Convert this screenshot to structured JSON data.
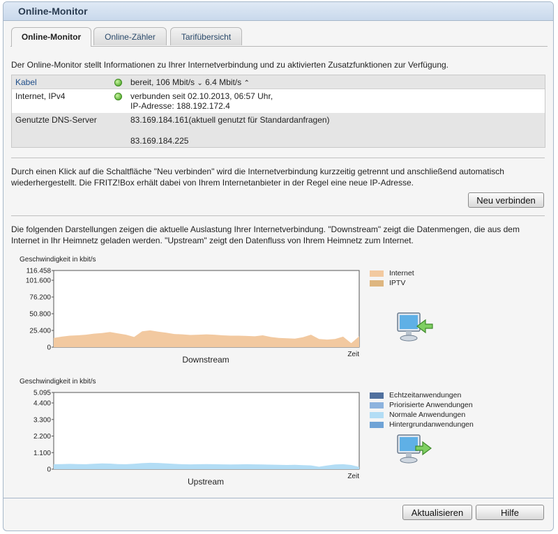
{
  "window": {
    "title": "Online-Monitor"
  },
  "tabs": [
    {
      "label": "Online-Monitor",
      "active": true
    },
    {
      "label": "Online-Zähler",
      "active": false
    },
    {
      "label": "Tarifübersicht",
      "active": false
    }
  ],
  "intro_text": "Der Online-Monitor stellt Informationen zu Ihrer Internetverbindung und zu aktivierten Zusatzfunktionen zur Verfügung.",
  "info_table": {
    "kabel": {
      "label": "Kabel",
      "status": "bereit, 106 Mbit/s",
      "down_arrow": "⌄",
      "upstream": "6.4 Mbit/s",
      "up_arrow": "⌃"
    },
    "internet": {
      "label": "Internet, IPv4",
      "line1": "verbunden seit 02.10.2013, 06:57 Uhr,",
      "line2": "IP-Adresse: 188.192.172.4"
    },
    "dns": {
      "label": "Genutzte DNS-Server",
      "server1": "83.169.184.161(aktuell genutzt für Standardanfragen)",
      "server2": "83.169.184.225"
    }
  },
  "reconnect_text": "Durch einen Klick auf die Schaltfläche \"Neu verbinden\" wird die Internetverbindung kurzzeitig getrennt und anschließend automatisch wiederhergestellt. Die FRITZ!Box erhält dabei von Ihrem Internetanbieter in der Regel eine neue IP-Adresse.",
  "reconnect_button": "Neu verbinden",
  "charts_text": "Die folgenden Darstellungen zeigen die aktuelle Auslastung Ihrer Internetverbindung. \"Downstream\" zeigt die Datenmengen, die aus dem Internet in Ihr Heimnetz geladen werden. \"Upstream\" zeigt den Datenfluss von Ihrem Heimnetz zum Internet.",
  "colors": {
    "internet": "#f2c9a0",
    "iptv": "#deb680",
    "echtzeit": "#50709e",
    "priorisiert": "#8db3de",
    "normal": "#b3ddf5",
    "hintergrund": "#6fa3d6",
    "upstream_fill": "#b3ddf5"
  },
  "chart_data": [
    {
      "type": "area",
      "title": "Downstream",
      "ylabel": "Geschwindigkeit in kbit/s",
      "xlabel": "Zeit",
      "ylim": [
        0,
        116458
      ],
      "yticks": [
        "116.458",
        "101.600",
        "76.200",
        "50.800",
        "25.400",
        "0"
      ],
      "ytick_values": [
        116458,
        101600,
        76200,
        50800,
        25400,
        0
      ],
      "series": [
        {
          "name": "Internet",
          "values": [
            14000,
            16000,
            17500,
            18000,
            19000,
            20500,
            21500,
            23000,
            21000,
            19000,
            15500,
            24000,
            25500,
            23500,
            22000,
            20000,
            19500,
            18500,
            19000,
            19500,
            19000,
            18000,
            17500,
            17500,
            17000,
            16500,
            18000,
            15500,
            14000,
            13500,
            13000,
            15000,
            19000,
            12500,
            11500,
            12500,
            16000,
            6000,
            16500
          ]
        },
        {
          "name": "IPTV",
          "values": []
        }
      ],
      "legend": [
        "Internet",
        "IPTV"
      ],
      "legend_position": "right"
    },
    {
      "type": "area",
      "title": "Upstream",
      "ylabel": "Geschwindigkeit in kbit/s",
      "xlabel": "Zeit",
      "ylim": [
        0,
        5095
      ],
      "yticks": [
        "5.095",
        "4.400",
        "3.300",
        "2.200",
        "1.100",
        "0"
      ],
      "ytick_values": [
        5095,
        4400,
        3300,
        2200,
        1100,
        0
      ],
      "series": [
        {
          "name": "Echtzeitanwendungen",
          "values": []
        },
        {
          "name": "Priorisierte Anwendungen",
          "values": []
        },
        {
          "name": "Normale Anwendungen",
          "values": [
            330,
            340,
            350,
            340,
            330,
            360,
            380,
            370,
            340,
            330,
            360,
            400,
            420,
            410,
            380,
            350,
            330,
            320,
            330,
            340,
            330,
            320,
            310,
            320,
            330,
            320,
            310,
            300,
            290,
            280,
            290,
            270,
            250,
            160,
            240,
            310,
            330,
            280,
            150
          ]
        },
        {
          "name": "Hintergrundanwendungen",
          "values": []
        }
      ],
      "legend": [
        "Echtzeitanwendungen",
        "Priorisierte Anwendungen",
        "Normale Anwendungen",
        "Hintergrundanwendungen"
      ],
      "legend_position": "right"
    }
  ],
  "footer": {
    "refresh_button": "Aktualisieren",
    "help_button": "Hilfe"
  }
}
